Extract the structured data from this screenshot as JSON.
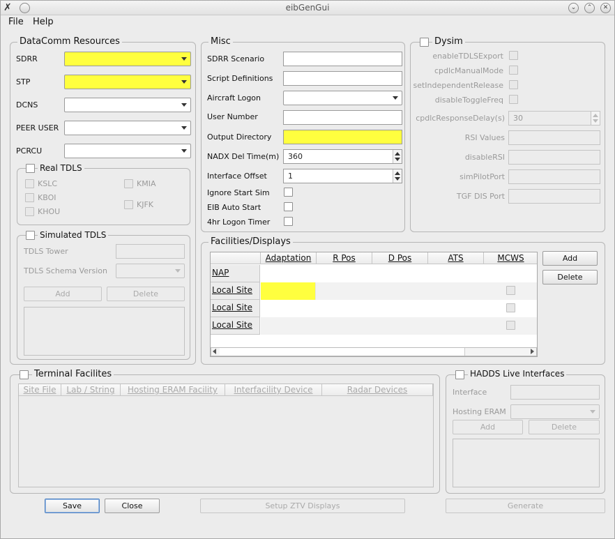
{
  "window": {
    "title": "eibGenGui"
  },
  "menu": {
    "file": "File",
    "help": "Help"
  },
  "datacomm": {
    "title": "DataComm Resources",
    "rows": [
      {
        "label": "SDRR"
      },
      {
        "label": "STP"
      },
      {
        "label": "DCNS"
      },
      {
        "label": "PEER USER"
      },
      {
        "label": "PCRCU"
      }
    ]
  },
  "real_tdls": {
    "title": "Real TDLS",
    "sites": [
      "KSLC",
      "KBOI",
      "KHOU",
      "KMIA",
      "KJFK"
    ]
  },
  "sim_tdls": {
    "title": "Simulated TDLS",
    "tower_label": "TDLS Tower",
    "schema_label": "TDLS Schema Version",
    "add": "Add",
    "delete": "Delete"
  },
  "misc": {
    "title": "Misc",
    "sdrr_scenario": "SDRR Scenario",
    "script_definitions": "Script Definitions",
    "aircraft_logon": "Aircraft Logon",
    "user_number": "User Number",
    "output_directory": "Output Directory",
    "nadx_label": "NADX Del Time(m)",
    "nadx_value": "360",
    "offset_label": "Interface Offset",
    "offset_value": "1",
    "ignore_start": "Ignore Start Sim",
    "eib_auto_start": "EIB Auto Start",
    "logon_timer": "4hr Logon Timer"
  },
  "dysim": {
    "title": "Dysim",
    "enable_tdls_export": "enableTDLSExport",
    "cpdlc_manual_mode": "cpdlcManualMode",
    "set_independent_release": "setIndependentRelease",
    "disable_toggle_freq": "disableToggleFreq",
    "cpdlc_response_delay": "cpdlcResponseDelay(s)",
    "cpdlc_response_value": "30",
    "rsi_values": "RSI Values",
    "disable_rsi": "disableRSI",
    "sim_pilot_port": "simPilotPort",
    "tgf_dis_port": "TGF DIS Port"
  },
  "facilities": {
    "title": "Facilities/Displays",
    "columns": [
      "Adaptation",
      "R Pos",
      "D Pos",
      "ATS",
      "MCWS"
    ],
    "rows": [
      "NAP",
      "Local Site",
      "Local Site",
      "Local Site"
    ],
    "add": "Add",
    "delete": "Delete"
  },
  "terminal": {
    "title": "Terminal Facilites",
    "columns": [
      "Site File",
      "Lab / String",
      "Hosting ERAM Facility",
      "Interfacility Device",
      "Radar Devices"
    ]
  },
  "hadds": {
    "title": "HADDS Live Interfaces",
    "interface_label": "Interface",
    "hosting_label": "Hosting ERAM",
    "add": "Add",
    "delete": "Delete"
  },
  "buttons": {
    "save": "Save",
    "close": "Close",
    "setup_ztv": "Setup ZTV Displays",
    "generate": "Generate"
  },
  "colors": {
    "required_field": "#ffff3f",
    "window_bg": "#ececec"
  }
}
